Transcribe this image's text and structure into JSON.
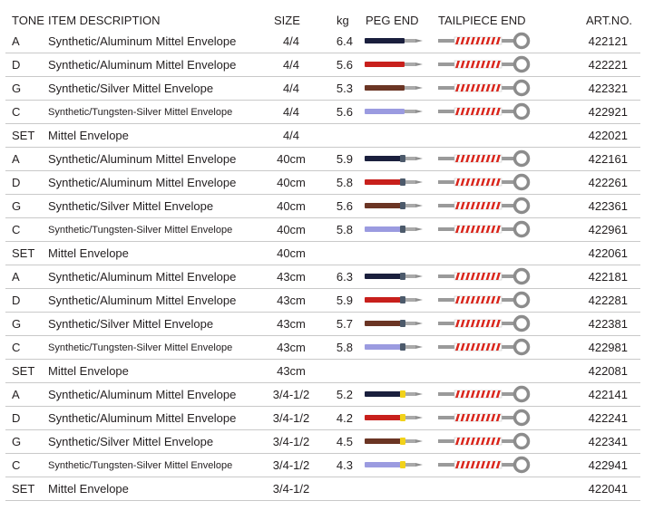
{
  "header": {
    "tone": "TONE",
    "item_description": "ITEM DESCRIPTION",
    "size": "SIZE",
    "kg": "kg",
    "peg_end": "PEG END",
    "tailpiece_end": "TAILPIECE END",
    "art_no": "ART.NO."
  },
  "colors": {
    "A": "#1a1f3d",
    "D": "#c8201c",
    "G": "#6b3524",
    "C": "#9b9be0",
    "tail_wrap": "#d9261c",
    "gray_band": "#4c5a6b",
    "yellow_band": "#f2d21a"
  },
  "rows": [
    {
      "tone": "A",
      "desc": "Synthetic/Aluminum Mittel Envelope",
      "size": "4/4",
      "kg": "6.4",
      "art": "422121",
      "peg": "plain"
    },
    {
      "tone": "D",
      "desc": "Synthetic/Aluminum Mittel Envelope",
      "size": "4/4",
      "kg": "5.6",
      "art": "422221",
      "peg": "plain"
    },
    {
      "tone": "G",
      "desc": "Synthetic/Silver Mittel Envelope",
      "size": "4/4",
      "kg": "5.3",
      "art": "422321",
      "peg": "plain"
    },
    {
      "tone": "C",
      "desc": "Synthetic/Tungsten-Silver Mittel Envelope",
      "size": "4/4",
      "kg": "5.6",
      "art": "422921",
      "peg": "plain"
    },
    {
      "tone": "SET",
      "desc": "Mittel Envelope",
      "size": "4/4",
      "kg": "",
      "art": "422021",
      "peg": "none"
    },
    {
      "tone": "A",
      "desc": "Synthetic/Aluminum Mittel Envelope",
      "size": "40cm",
      "kg": "5.9",
      "art": "422161",
      "peg": "gray"
    },
    {
      "tone": "D",
      "desc": "Synthetic/Aluminum Mittel Envelope",
      "size": "40cm",
      "kg": "5.8",
      "art": "422261",
      "peg": "gray"
    },
    {
      "tone": "G",
      "desc": "Synthetic/Silver Mittel Envelope",
      "size": "40cm",
      "kg": "5.6",
      "art": "422361",
      "peg": "gray"
    },
    {
      "tone": "C",
      "desc": "Synthetic/Tungsten-Silver Mittel Envelope",
      "size": "40cm",
      "kg": "5.8",
      "art": "422961",
      "peg": "gray"
    },
    {
      "tone": "SET",
      "desc": "Mittel Envelope",
      "size": "40cm",
      "kg": "",
      "art": "422061",
      "peg": "none"
    },
    {
      "tone": "A",
      "desc": "Synthetic/Aluminum Mittel Envelope",
      "size": "43cm",
      "kg": "6.3",
      "art": "422181",
      "peg": "gray"
    },
    {
      "tone": "D",
      "desc": "Synthetic/Aluminum Mittel Envelope",
      "size": "43cm",
      "kg": "5.9",
      "art": "422281",
      "peg": "gray"
    },
    {
      "tone": "G",
      "desc": "Synthetic/Silver Mittel Envelope",
      "size": "43cm",
      "kg": "5.7",
      "art": "422381",
      "peg": "gray"
    },
    {
      "tone": "C",
      "desc": "Synthetic/Tungsten-Silver Mittel Envelope",
      "size": "43cm",
      "kg": "5.8",
      "art": "422981",
      "peg": "gray"
    },
    {
      "tone": "SET",
      "desc": "Mittel Envelope",
      "size": "43cm",
      "kg": "",
      "art": "422081",
      "peg": "none"
    },
    {
      "tone": "A",
      "desc": "Synthetic/Aluminum Mittel Envelope",
      "size": "3/4-1/2",
      "kg": "5.2",
      "art": "422141",
      "peg": "yellow"
    },
    {
      "tone": "D",
      "desc": "Synthetic/Aluminum Mittel Envelope",
      "size": "3/4-1/2",
      "kg": "4.2",
      "art": "422241",
      "peg": "yellow"
    },
    {
      "tone": "G",
      "desc": "Synthetic/Silver Mittel Envelope",
      "size": "3/4-1/2",
      "kg": "4.5",
      "art": "422341",
      "peg": "yellow"
    },
    {
      "tone": "C",
      "desc": "Synthetic/Tungsten-Silver Mittel Envelope",
      "size": "3/4-1/2",
      "kg": "4.3",
      "art": "422941",
      "peg": "yellow"
    },
    {
      "tone": "SET",
      "desc": "Mittel Envelope",
      "size": "3/4-1/2",
      "kg": "",
      "art": "422041",
      "peg": "none"
    }
  ]
}
